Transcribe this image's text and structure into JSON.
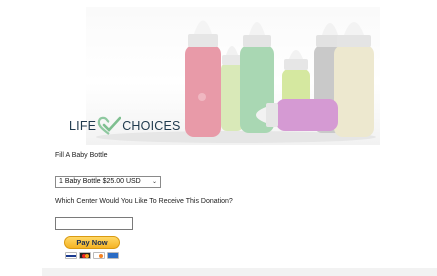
{
  "hero": {
    "image_alt": "Baby bottles",
    "bottles": [
      {
        "color": "#e89aa8"
      },
      {
        "color": "#cfe3a6"
      },
      {
        "color": "#a9d7b3"
      },
      {
        "color": "#d5e8a0"
      },
      {
        "color": "#c9c9c9"
      },
      {
        "color": "#ede8cf"
      },
      {
        "color": "#d59ad3"
      }
    ]
  },
  "logo": {
    "word1": "LIFE",
    "word2": "CHOICES",
    "heart_color": "#8fc9a0",
    "text_color": "#1f3a4d"
  },
  "form": {
    "title": "Fill A Baby Bottle",
    "option_selected": "1 Baby Bottle $25.00 USD",
    "question": "Which Center Would You Like To Receive This Donation?",
    "center_value": ""
  },
  "paypal": {
    "button_label": "Pay Now",
    "cards": [
      "visa-icon",
      "mastercard-icon",
      "discover-icon",
      "amex-icon"
    ]
  }
}
